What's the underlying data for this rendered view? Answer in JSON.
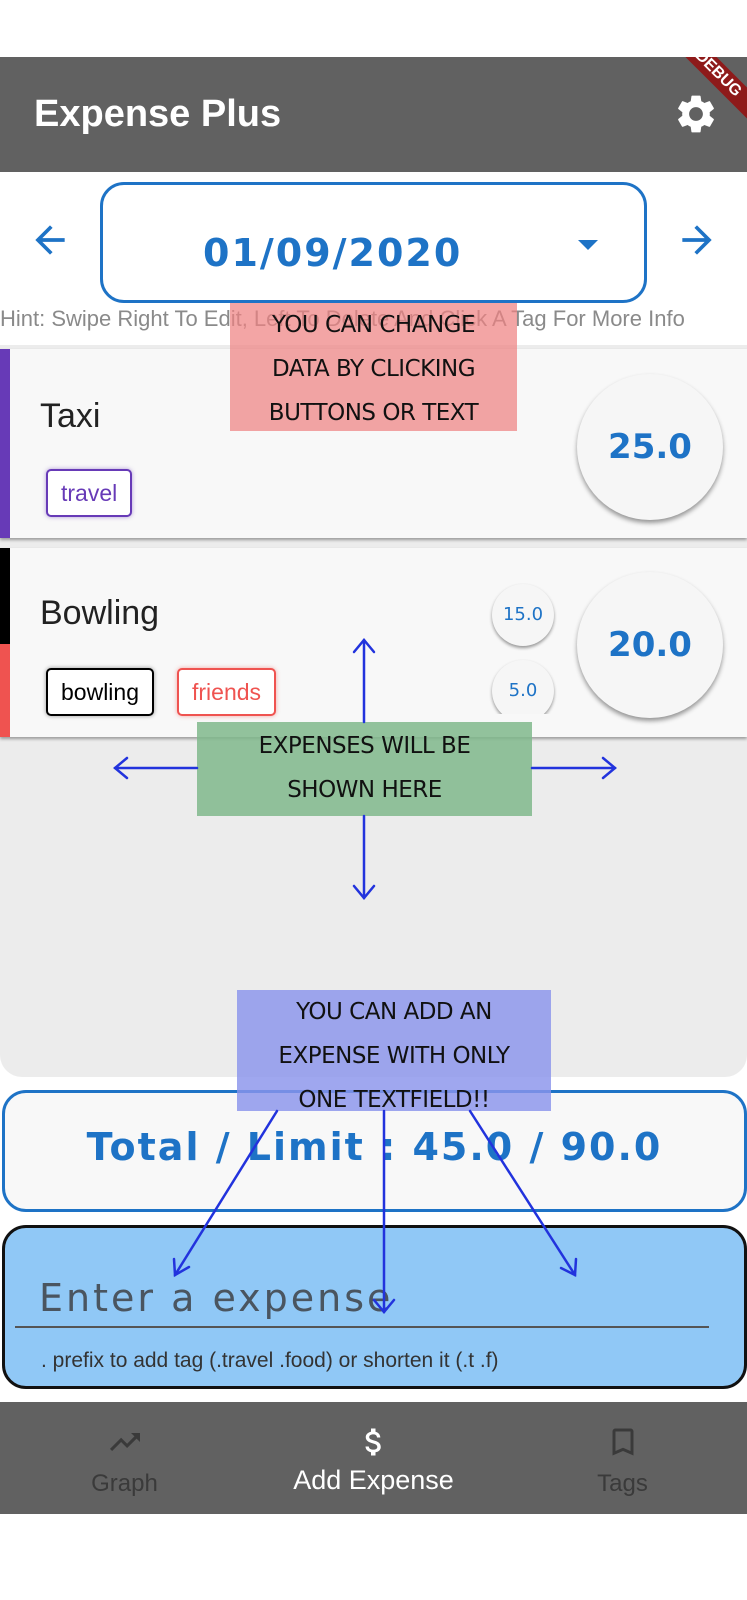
{
  "app_bar": {
    "title": "Expense Plus",
    "debug_label": "DEBUG"
  },
  "date_selector": {
    "date": "01/09/2020"
  },
  "hint": "Hint: Swipe Right To Edit, Left To Delete And Click A Tag For More Info",
  "expenses": [
    {
      "name": "Taxi",
      "total": "25.0",
      "stripe_colors": [
        "#673ab7"
      ],
      "tags": [
        {
          "label": "travel",
          "color": "#673ab7"
        }
      ],
      "sub_amounts": []
    },
    {
      "name": "Bowling",
      "total": "20.0",
      "stripe_colors": [
        "#000000",
        "#ef5350"
      ],
      "tags": [
        {
          "label": "bowling",
          "color": "#000000"
        },
        {
          "label": "friends",
          "color": "#ef5350"
        }
      ],
      "sub_amounts": [
        "15.0",
        "5.0"
      ]
    }
  ],
  "annotations": {
    "change_data": [
      "YOU CAN CHANGE",
      "DATA BY CLICKING",
      "BUTTONS OR TEXT"
    ],
    "expenses_shown": [
      "EXPENSES WILL BE",
      "SHOWN HERE"
    ],
    "add_expense": [
      "YOU CAN ADD AN",
      "EXPENSE WITH ONLY",
      "ONE TEXTFIELD!!"
    ]
  },
  "total": {
    "text": "Total / Limit : 45.0 / 90.0"
  },
  "input": {
    "placeholder": "Enter a expense",
    "helper": ". prefix to add tag (.travel .food) or shorten it (.t .f)"
  },
  "bottom_nav": [
    {
      "label": "Graph",
      "icon": "trending-up-icon",
      "active": false
    },
    {
      "label": "Add Expense",
      "icon": "dollar-icon",
      "active": true
    },
    {
      "label": "Tags",
      "icon": "bookmark-icon",
      "active": false
    }
  ],
  "colors": {
    "app_bar": "#616161",
    "accent": "#1e73c6",
    "input_bg": "#90c8f6",
    "note_red": "#ef9a9a",
    "note_green": "#8fbf9a",
    "note_blue": "#9aa3ec"
  }
}
